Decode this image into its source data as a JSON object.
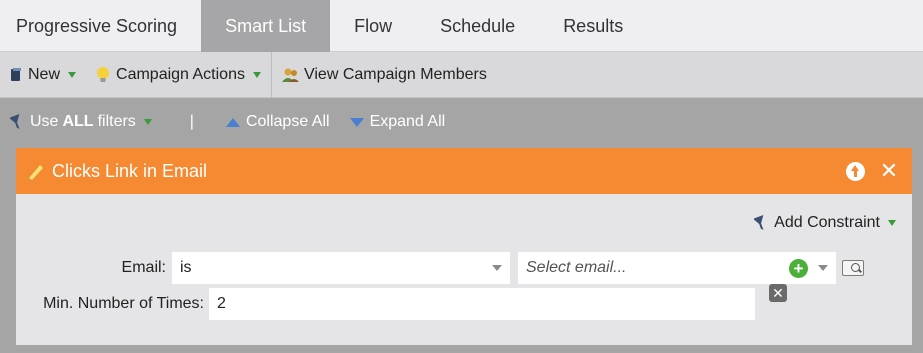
{
  "tabs": [
    {
      "label": "Progressive Scoring",
      "active": false
    },
    {
      "label": "Smart List",
      "active": true
    },
    {
      "label": "Flow",
      "active": false
    },
    {
      "label": "Schedule",
      "active": false
    },
    {
      "label": "Results",
      "active": false
    }
  ],
  "toolbar": {
    "new_label": "New",
    "campaign_actions_label": "Campaign Actions",
    "view_members_label": "View Campaign Members"
  },
  "filterbar": {
    "use_prefix": "Use",
    "use_bold": "ALL",
    "use_suffix": "filters",
    "separator": "|",
    "collapse_label": "Collapse All",
    "expand_label": "Expand All"
  },
  "panel": {
    "title": "Clicks Link in Email",
    "add_constraint_label": "Add Constraint",
    "email_label": "Email:",
    "email_operator": "is",
    "email_placeholder": "Select email...",
    "min_times_label": "Min. Number of Times:",
    "min_times_value": "2"
  },
  "colors": {
    "panel_header": "#f58a32",
    "active_tab": "#a6a6a8",
    "background": "#a5a5a5"
  }
}
